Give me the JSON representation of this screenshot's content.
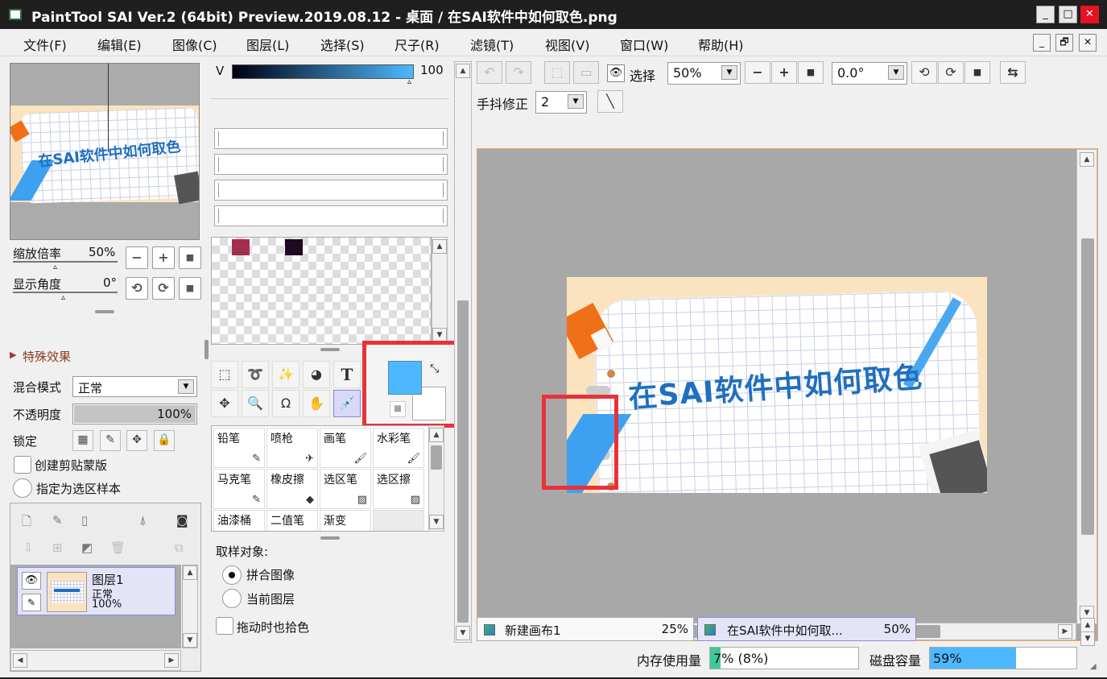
{
  "window": {
    "title": "PaintTool SAI Ver.2 (64bit) Preview.2019.08.12 - 桌面 / 在SAI软件中如何取色.png",
    "minimize": "_",
    "maximize": "□",
    "close": "✕"
  },
  "menu": [
    "文件(F)",
    "编辑(E)",
    "图像(C)",
    "图层(L)",
    "选择(S)",
    "尺子(R)",
    "滤镜(T)",
    "视图(V)",
    "窗口(W)",
    "帮助(H)"
  ],
  "mdi": {
    "minimize": "_",
    "restore": "🗗",
    "close": "✕"
  },
  "image_text": "在SAI软件中如何取色",
  "navigator": {
    "zoom_label": "缩放倍率",
    "zoom_value": "50%",
    "angle_label": "显示角度",
    "angle_value": "0°",
    "minus": "−",
    "plus": "+",
    "reset": "■",
    "rot_ccw": "⟲",
    "rot_cw": "⟳"
  },
  "effects": {
    "label": "特殊效果"
  },
  "layer_props": {
    "blend_label": "混合模式",
    "blend_value": "正常",
    "opacity_label": "不透明度",
    "opacity_value": "100%",
    "opacity_fraction": 1.0,
    "lock_label": "锁定",
    "clip_label": "创建剪贴蒙版",
    "sample_label": "指定为选区样本"
  },
  "layers": [
    {
      "name": "图层1",
      "mode": "正常",
      "opacity": "100%"
    }
  ],
  "color": {
    "channel_label": "V",
    "channel_value": "100",
    "swatches": [
      "#a0304e",
      "#1e0a22"
    ],
    "primary": "#4db8ff",
    "secondary": "#ffffff"
  },
  "tools": {
    "text_tool": "T"
  },
  "brushes": [
    {
      "name": "铅笔",
      "icon": "✎"
    },
    {
      "name": "喷枪",
      "icon": "✈"
    },
    {
      "name": "画笔",
      "icon": "🖌"
    },
    {
      "name": "水彩笔",
      "icon": "🖌"
    },
    {
      "name": "马克笔",
      "icon": "✎"
    },
    {
      "name": "橡皮擦",
      "icon": "◆"
    },
    {
      "name": "选区笔",
      "icon": "▨"
    },
    {
      "name": "选区擦",
      "icon": "▨"
    },
    {
      "name": "油漆桶",
      "icon": ""
    },
    {
      "name": "二值笔",
      "icon": ""
    },
    {
      "name": "渐变",
      "icon": ""
    },
    {
      "name": "",
      "icon": ""
    }
  ],
  "picker": {
    "sample_label": "取样对象:",
    "option1": "拼合图像",
    "option2": "当前图层",
    "drag_label": "拖动时也拾色"
  },
  "toolbar": {
    "select_label": "选择",
    "zoom_value": "50%",
    "angle_value": "0.0°",
    "minus": "−",
    "plus": "+",
    "reset": "■",
    "stabilizer_label": "手抖修正",
    "stabilizer_value": "2",
    "flip": "⇆"
  },
  "tabs": [
    {
      "name": "新建画布1",
      "zoom": "25%"
    },
    {
      "name": "在SAI软件中如何取...",
      "zoom": "50%"
    }
  ],
  "status": {
    "memory_label": "内存使用量",
    "memory_value": "7% (8%)",
    "memory_fraction": 0.07,
    "disk_label": "磁盘容量",
    "disk_value": "59%",
    "disk_fraction": 0.59
  }
}
